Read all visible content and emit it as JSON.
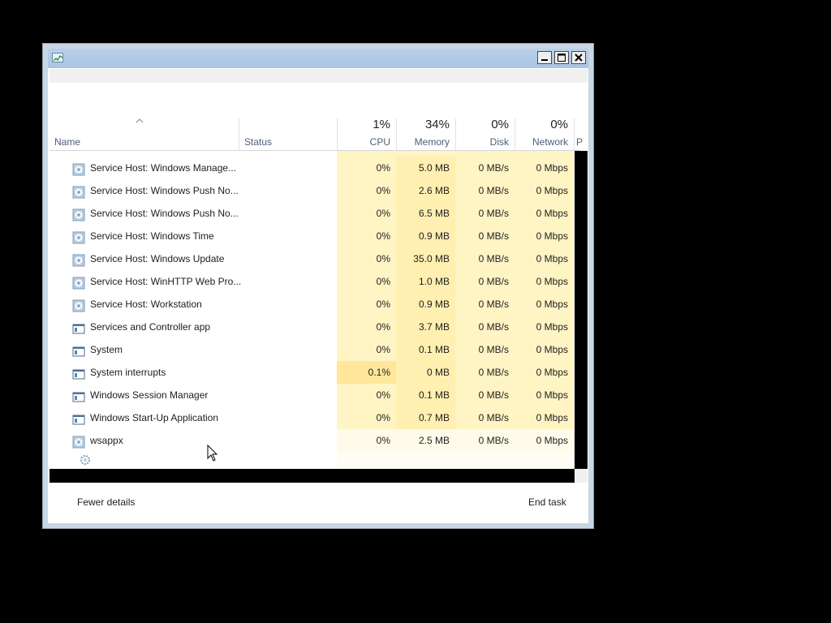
{
  "window": {
    "title": "",
    "icons": {
      "app": "task-manager-icon",
      "minimize": "minimize-icon",
      "maximize": "maximize-icon",
      "close": "close-icon"
    }
  },
  "columns": {
    "name": {
      "label": "Name"
    },
    "status": {
      "label": "Status"
    },
    "cpu": {
      "label": "CPU",
      "percent": "1%"
    },
    "memory": {
      "label": "Memory",
      "percent": "34%"
    },
    "disk": {
      "label": "Disk",
      "percent": "0%"
    },
    "network": {
      "label": "Network",
      "percent": "0%"
    },
    "power": {
      "label": "P"
    }
  },
  "processes": [
    {
      "name": "Service Host: Windows Manage...",
      "icon": "gear-icon",
      "status": "",
      "cpu": "0%",
      "memory": "5.0 MB",
      "disk": "0 MB/s",
      "network": "0 Mbps"
    },
    {
      "name": "Service Host: Windows Push No...",
      "icon": "gear-icon",
      "status": "",
      "cpu": "0%",
      "memory": "2.6 MB",
      "disk": "0 MB/s",
      "network": "0 Mbps"
    },
    {
      "name": "Service Host: Windows Push No...",
      "icon": "gear-icon",
      "status": "",
      "cpu": "0%",
      "memory": "6.5 MB",
      "disk": "0 MB/s",
      "network": "0 Mbps"
    },
    {
      "name": "Service Host: Windows Time",
      "icon": "gear-icon",
      "status": "",
      "cpu": "0%",
      "memory": "0.9 MB",
      "disk": "0 MB/s",
      "network": "0 Mbps"
    },
    {
      "name": "Service Host: Windows Update",
      "icon": "gear-icon",
      "status": "",
      "cpu": "0%",
      "memory": "35.0 MB",
      "disk": "0 MB/s",
      "network": "0 Mbps"
    },
    {
      "name": "Service Host: WinHTTP Web Pro...",
      "icon": "gear-icon",
      "status": "",
      "cpu": "0%",
      "memory": "1.0 MB",
      "disk": "0 MB/s",
      "network": "0 Mbps"
    },
    {
      "name": "Service Host: Workstation",
      "icon": "gear-icon",
      "status": "",
      "cpu": "0%",
      "memory": "0.9 MB",
      "disk": "0 MB/s",
      "network": "0 Mbps"
    },
    {
      "name": "Services and Controller app",
      "icon": "window-icon",
      "status": "",
      "cpu": "0%",
      "memory": "3.7 MB",
      "disk": "0 MB/s",
      "network": "0 Mbps"
    },
    {
      "name": "System",
      "icon": "window-icon",
      "status": "",
      "cpu": "0%",
      "memory": "0.1 MB",
      "disk": "0 MB/s",
      "network": "0 Mbps"
    },
    {
      "name": "System interrupts",
      "icon": "window-icon",
      "status": "",
      "cpu": "0.1%",
      "memory": "0 MB",
      "disk": "0 MB/s",
      "network": "0 Mbps"
    },
    {
      "name": "Windows Session Manager",
      "icon": "window-icon",
      "status": "",
      "cpu": "0%",
      "memory": "0.1 MB",
      "disk": "0 MB/s",
      "network": "0 Mbps"
    },
    {
      "name": "Windows Start-Up Application",
      "icon": "window-icon",
      "status": "",
      "cpu": "0%",
      "memory": "0.7 MB",
      "disk": "0 MB/s",
      "network": "0 Mbps"
    },
    {
      "name": "wsappx",
      "icon": "gear-icon",
      "status": "",
      "cpu": "0%",
      "memory": "2.5 MB",
      "disk": "0 MB/s",
      "network": "0 Mbps"
    }
  ],
  "footer": {
    "fewer_details": "Fewer details",
    "end_task": "End task"
  },
  "colors": {
    "heat_light": "#fff4c4",
    "heat_mid": "#ffefb0",
    "heat_high": "#ffe69a",
    "header_text": "#4c607a"
  }
}
